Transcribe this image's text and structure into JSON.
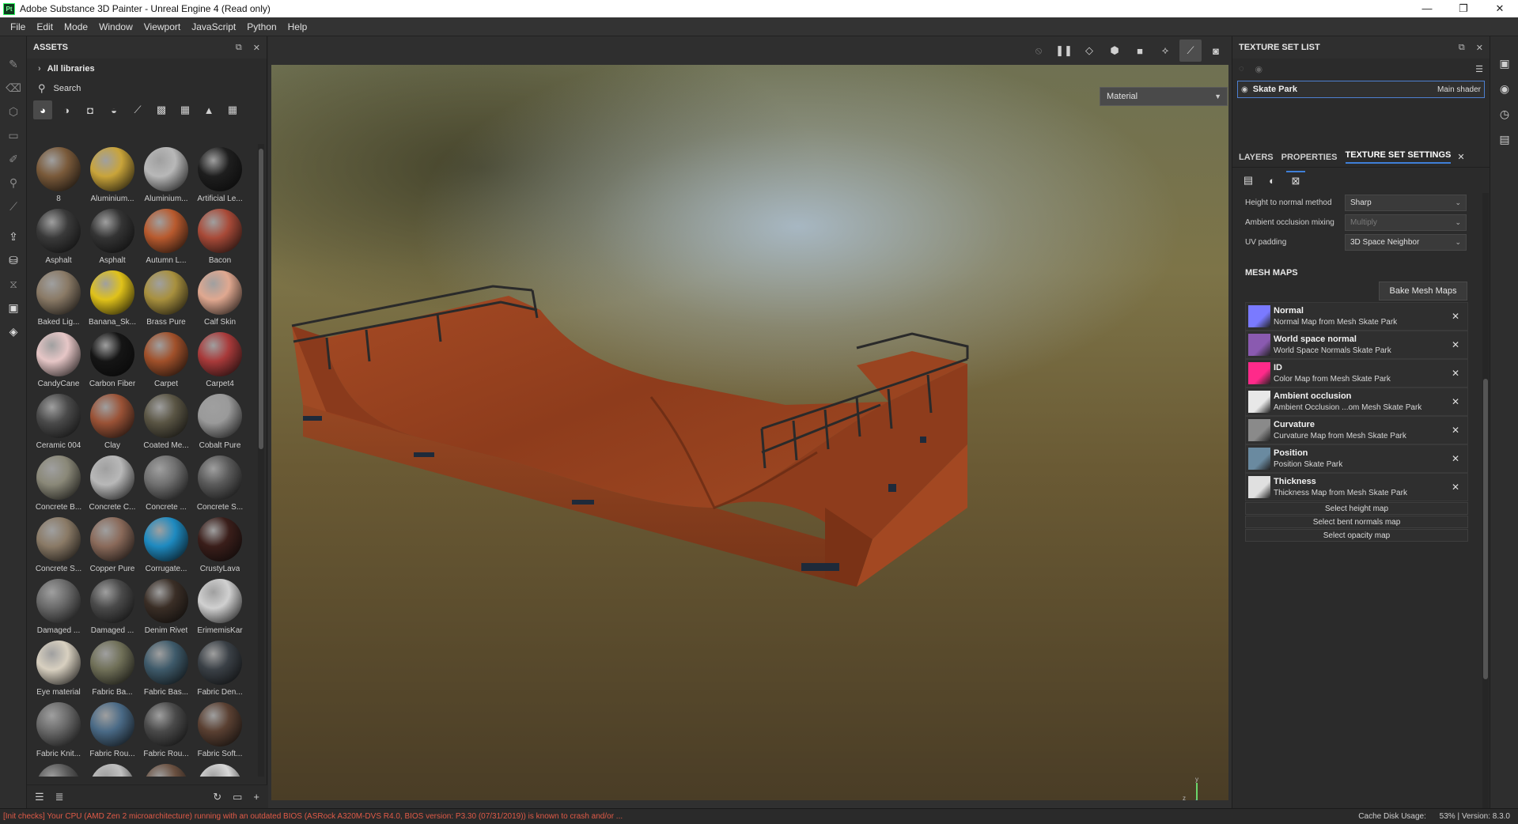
{
  "window": {
    "title": "Adobe Substance 3D Painter - Unreal Engine 4 (Read only)",
    "logo_text": "Pt",
    "minimize": "—",
    "maximize": "❐",
    "close": "✕"
  },
  "menu": [
    "File",
    "Edit",
    "Mode",
    "Window",
    "Viewport",
    "JavaScript",
    "Python",
    "Help"
  ],
  "assets": {
    "title": "ASSETS",
    "library": "All libraries",
    "search_placeholder": "Search",
    "items": [
      {
        "label": "8",
        "color": "#7a5a3a"
      },
      {
        "label": "Aluminium...",
        "color": "#c9a43a"
      },
      {
        "label": "Aluminium...",
        "color": "#b8b8b8"
      },
      {
        "label": "Artificial Le...",
        "color": "#1e1e1e"
      },
      {
        "label": "Asphalt",
        "color": "#3a3a3a"
      },
      {
        "label": "Asphalt",
        "color": "#343434"
      },
      {
        "label": "Autumn L...",
        "color": "#b85a2e"
      },
      {
        "label": "Bacon",
        "color": "#a84a38"
      },
      {
        "label": "Baked Lig...",
        "color": "#8a7a66"
      },
      {
        "label": "Banana_Sk...",
        "color": "#e0c21a"
      },
      {
        "label": "Brass Pure",
        "color": "#a8903e"
      },
      {
        "label": "Calf Skin",
        "color": "#e0a890"
      },
      {
        "label": "CandyCane",
        "color": "#e6c6c6"
      },
      {
        "label": "Carbon Fiber",
        "color": "#151515"
      },
      {
        "label": "Carpet",
        "color": "#a0502a"
      },
      {
        "label": "Carpet4",
        "color": "#a83a3a"
      },
      {
        "label": "Ceramic 004",
        "color": "#4a4a4a"
      },
      {
        "label": "Clay",
        "color": "#9a5236"
      },
      {
        "label": "Coated Me...",
        "color": "#5a5544"
      },
      {
        "label": "Cobalt Pure",
        "color": "#9a9a9a"
      },
      {
        "label": "Concrete B...",
        "color": "#8a8878"
      },
      {
        "label": "Concrete C...",
        "color": "#b8b8b8"
      },
      {
        "label": "Concrete ...",
        "color": "#707070"
      },
      {
        "label": "Concrete S...",
        "color": "#5a5a5a"
      },
      {
        "label": "Concrete S...",
        "color": "#8a7a66"
      },
      {
        "label": "Copper Pure",
        "color": "#8a6a5a"
      },
      {
        "label": "Corrugate...",
        "color": "#1e8ac0"
      },
      {
        "label": "CrustyLava",
        "color": "#3a1e1a"
      },
      {
        "label": "Damaged ...",
        "color": "#6a6a6a"
      },
      {
        "label": "Damaged ...",
        "color": "#4a4a4a"
      },
      {
        "label": "Denim Rivet",
        "color": "#3a2e26"
      },
      {
        "label": "ErimemisKar",
        "color": "#d0d0d0"
      },
      {
        "label": "Eye material",
        "color": "#d8d0c0"
      },
      {
        "label": "Fabric Ba...",
        "color": "#707058"
      },
      {
        "label": "Fabric Bas...",
        "color": "#3e5a6a"
      },
      {
        "label": "Fabric Den...",
        "color": "#3a4046"
      },
      {
        "label": "Fabric Knit...",
        "color": "#6a6a6a"
      },
      {
        "label": "Fabric Rou...",
        "color": "#4a6a86"
      },
      {
        "label": "Fabric Rou...",
        "color": "#4a4a4a"
      },
      {
        "label": "Fabric Soft...",
        "color": "#5a4032"
      },
      {
        "label": "",
        "color": "#5a5a5a"
      },
      {
        "label": "",
        "color": "#c0c0c0"
      },
      {
        "label": "",
        "color": "#6a5040"
      },
      {
        "label": "",
        "color": "#d8d8d8"
      }
    ]
  },
  "viewport": {
    "display_mode": "Material",
    "axis_y": "y",
    "axis_z": "z"
  },
  "texture_set_list": {
    "title": "TEXTURE SET LIST",
    "set_name": "Skate Park",
    "shader": "Main shader"
  },
  "tabs": {
    "layers": "LAYERS",
    "properties": "PROPERTIES",
    "texture_set_settings": "TEXTURE SET SETTINGS"
  },
  "settings": [
    {
      "key": "Height to normal method",
      "value": "Sharp",
      "disabled": false
    },
    {
      "key": "Ambient occlusion mixing",
      "value": "Multiply",
      "disabled": true
    },
    {
      "key": "UV padding",
      "value": "3D Space Neighbor",
      "disabled": false
    }
  ],
  "mesh_maps": {
    "title": "MESH MAPS",
    "bake_button": "Bake Mesh Maps",
    "maps": [
      {
        "name": "Normal",
        "desc": "Normal Map from Mesh Skate Park",
        "color": "#7a7aff"
      },
      {
        "name": "World space normal",
        "desc": "World Space Normals Skate Park",
        "color": "#8a5ab0"
      },
      {
        "name": "ID",
        "desc": "Color Map from Mesh Skate Park",
        "color": "#ff2a8a"
      },
      {
        "name": "Ambient occlusion",
        "desc": "Ambient Occlusion ...om Mesh Skate Park",
        "color": "#e8e8e8"
      },
      {
        "name": "Curvature",
        "desc": "Curvature Map from Mesh Skate Park",
        "color": "#8a8a8a"
      },
      {
        "name": "Position",
        "desc": "Position Skate Park",
        "color": "#6a8aa0"
      },
      {
        "name": "Thickness",
        "desc": "Thickness Map from Mesh Skate Park",
        "color": "#e0e0e0"
      }
    ],
    "select_height": "Select height map",
    "select_bent": "Select bent normals map",
    "select_opacity": "Select opacity map"
  },
  "status": {
    "error": "[Init checks] Your CPU (AMD Zen 2 microarchitecture) running with an outdated BIOS (ASRock A320M-DVS R4.0, BIOS version: P3.30 (07/31/2019)) is known to crash and/or ...",
    "cache": "Cache Disk Usage:",
    "cache_value": "53%",
    "version": "Version: 8.3.0"
  }
}
